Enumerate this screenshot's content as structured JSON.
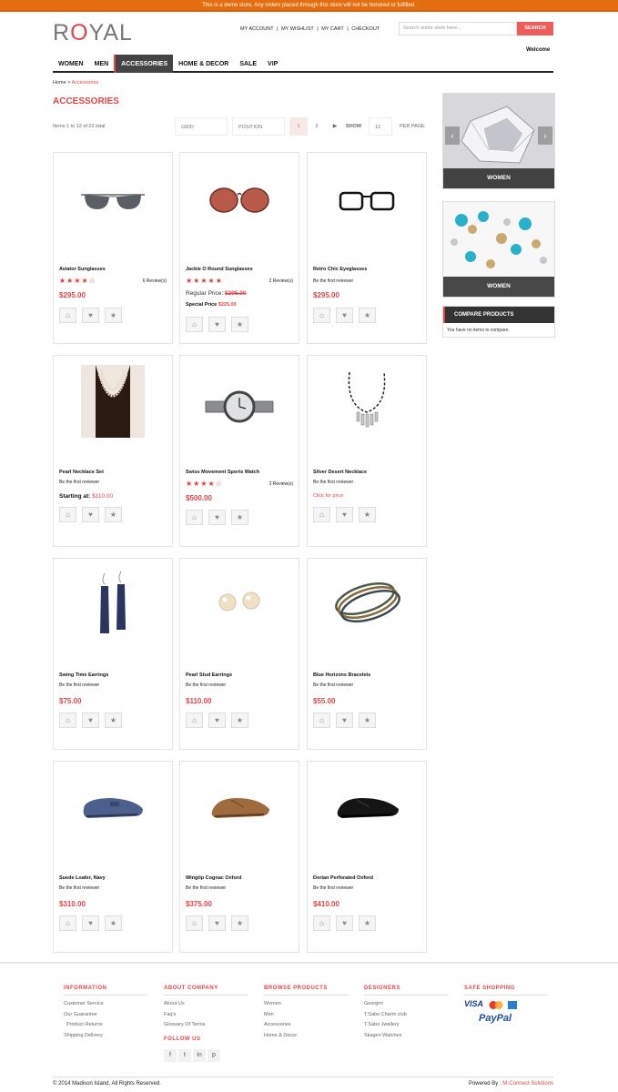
{
  "demo_notice": "This is a demo store. Any orders placed through this store will not be honored or fulfilled.",
  "logo": {
    "part1": "R",
    "part2": "O",
    "part3": "YAL"
  },
  "top_links": [
    "MY ACCOUNT",
    "|",
    "MY WISHLIST",
    "|",
    "MY CART",
    "|",
    "CHECKOUT"
  ],
  "search": {
    "placeholder": "Search entire store here...",
    "button": "SEARCH"
  },
  "welcome": "Welcome",
  "nav": [
    "WOMEN",
    "MEN",
    "ACCESSORIES",
    "HOME & DECOR",
    "SALE",
    "VIP"
  ],
  "breadcrumb": {
    "home": "Home",
    "sep": " > ",
    "current": "Accessories"
  },
  "page_title": "ACCESSORIES",
  "toolbar": {
    "count": "Items 1 to 12 of 22 total",
    "view": "GRID",
    "sort": "POSITION",
    "pages": [
      "1",
      "2"
    ],
    "next": "▶",
    "show_label": "SHOW",
    "show_value": "12",
    "per_page": "PER PAGE"
  },
  "products": [
    {
      "name": "Aviator Sunglasses",
      "stars": "★★★★☆",
      "reviews": "6 Review(s)",
      "price": "$295.00"
    },
    {
      "name": "Jackie O Round Sunglasses",
      "stars": "★★★★★",
      "reviews": "2 Review(s)",
      "regular_label": "Regular Price:",
      "regular_price": "$295.00",
      "special_label": "Special Price",
      "special_price": "$225.00"
    },
    {
      "name": "Retro Chic Eyeglasses",
      "first": "Be the first reviewer",
      "price": "$295.00"
    },
    {
      "name": "Pearl Necklace Set",
      "first": "Be the first reviewer",
      "starting_label": "Starting at:",
      "starting_price": "$110.00"
    },
    {
      "name": "Swiss Movement Sports Watch",
      "stars": "★★★★☆",
      "reviews": "2 Review(s)",
      "price": "$500.00"
    },
    {
      "name": "Silver Desert Necklace",
      "first": "Be the first reviewer",
      "click_price": "Click for price"
    },
    {
      "name": "Swing Time Earrings",
      "first": "Be the first reviewer",
      "price": "$75.00"
    },
    {
      "name": "Pearl Stud Earrings",
      "first": "Be the first reviewer",
      "price": "$110.00"
    },
    {
      "name": "Blue Horizons Bracelets",
      "first": "Be the first reviewer",
      "price": "$55.00"
    },
    {
      "name": "Suede Loafer, Navy",
      "first": "Be the first reviewer",
      "price": "$310.00"
    },
    {
      "name": "Wingtip Cognac Oxford",
      "first": "Be the first reviewer",
      "price": "$375.00"
    },
    {
      "name": "Dorian Perforated Oxford",
      "first": "Be the first reviewer",
      "price": "$410.00"
    }
  ],
  "sidebar": {
    "banner1_label": "WOMEN",
    "banner2_label": "WOMEN",
    "compare_title": "COMPARE PRODUCTS",
    "compare_text": "You have no items to compare."
  },
  "footer": {
    "information": {
      "title": "INFORMATION",
      "links": [
        "Customer Service",
        "Our Guarantee",
        "Product Returns",
        "Shipping Delivery"
      ]
    },
    "about": {
      "title": "ABOUT COMPANY",
      "links": [
        "About Us",
        "Faq's",
        "Glossary Of Terms"
      ]
    },
    "follow": {
      "title": "FOLLOW US",
      "icons": [
        "f",
        "t",
        "in",
        "p"
      ]
    },
    "browse": {
      "title": "BROWSE PRODUCTS",
      "links": [
        "Women",
        "Men",
        "Accessories",
        "Home & Decor"
      ]
    },
    "designers": {
      "title": "DESIGNERS",
      "links": [
        "Georgini",
        "T.Sabo Charm club",
        "T.Sabo Jwellery",
        "Skagen Watches"
      ]
    },
    "shopping": {
      "title": "SAFE SHOPPING",
      "visa": "VISA",
      "paypal": "PayPal"
    },
    "copyright": "© 2014 Madison Island. All Rights Reserved.",
    "powered_label": "Powered By :",
    "powered_name": "M-Connect Solutions"
  }
}
